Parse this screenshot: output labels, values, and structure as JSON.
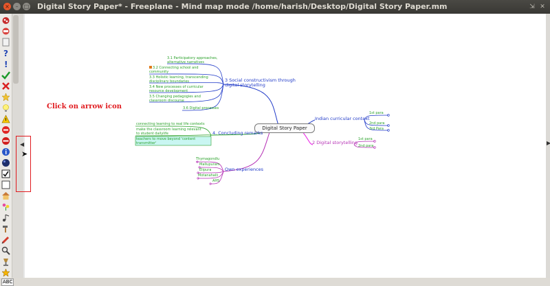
{
  "window": {
    "title": "Digital Story Paper* - Freeplane - Mind map mode /home/harish/Desktop/Digital Story Paper.mm",
    "controls": [
      "×",
      "–",
      "□"
    ],
    "right_controls": [
      "⇲",
      "✕"
    ]
  },
  "annotation": {
    "text": "Click on arrow icon",
    "color": "#e0191d"
  },
  "statusbar": {
    "label": "ABC"
  },
  "toolbar_icons": [
    "bug-icon",
    "plant-icon",
    "question-icon",
    "exclamation-icon",
    "check-icon",
    "cross-icon",
    "star-icon",
    "lightbulb-icon",
    "warning-icon",
    "stop-icon",
    "no-entry-icon",
    "info-icon",
    "ball-icon",
    "checkbox-checked-icon",
    "checkbox-empty-icon",
    "house-icon",
    "flowers-icon",
    "music-icon",
    "hammer-icon",
    "pencil-icon",
    "magnifier-icon",
    "lamp-icon",
    "trophy-icon"
  ],
  "mindmap": {
    "root": "Digital Story Paper",
    "colors": {
      "blue": "#1f39c8",
      "green": "#2aa12a",
      "magenta": "#b52fb5",
      "cyan_fill": "#c9f6f2"
    },
    "social": {
      "label": "3 Social constructivism through digital storytelling",
      "line1": "3 Social constructivism through",
      "line2": "digital storytelling",
      "children": [
        [
          "3.1 Participatory approaches,",
          "alternative narratives"
        ],
        [
          "3.2 Connecting school and",
          "community"
        ],
        [
          "3.3 Holistic learning, transcending",
          "disciplinary boundaries"
        ],
        [
          "3.4 New processes of curricular",
          "resource development"
        ],
        [
          "3.5 Changing pedagogies and",
          "classroom discourse"
        ],
        [
          "3.6 Digital processes"
        ]
      ]
    },
    "concluding": {
      "label": "4. Concluding remarks",
      "children": [
        [
          "connecting learning to real life contexts"
        ],
        [
          "make the classroom learning  relevant",
          "to  student dailylife"
        ],
        [
          "teachers to move beyond 'content",
          "transmitter'"
        ]
      ]
    },
    "own": {
      "label": "Own experiences",
      "children": [
        "Thymagondlu",
        "Mallupuram",
        "Elipura",
        "Motanahalli",
        "AHS"
      ]
    },
    "indian": {
      "label": "Indian curricular context",
      "children": [
        "1st para",
        "2nd para",
        "3rd Para"
      ]
    },
    "digital": {
      "label": "2 Digital storytelling",
      "children": [
        "1st para",
        "2nd para"
      ]
    }
  }
}
